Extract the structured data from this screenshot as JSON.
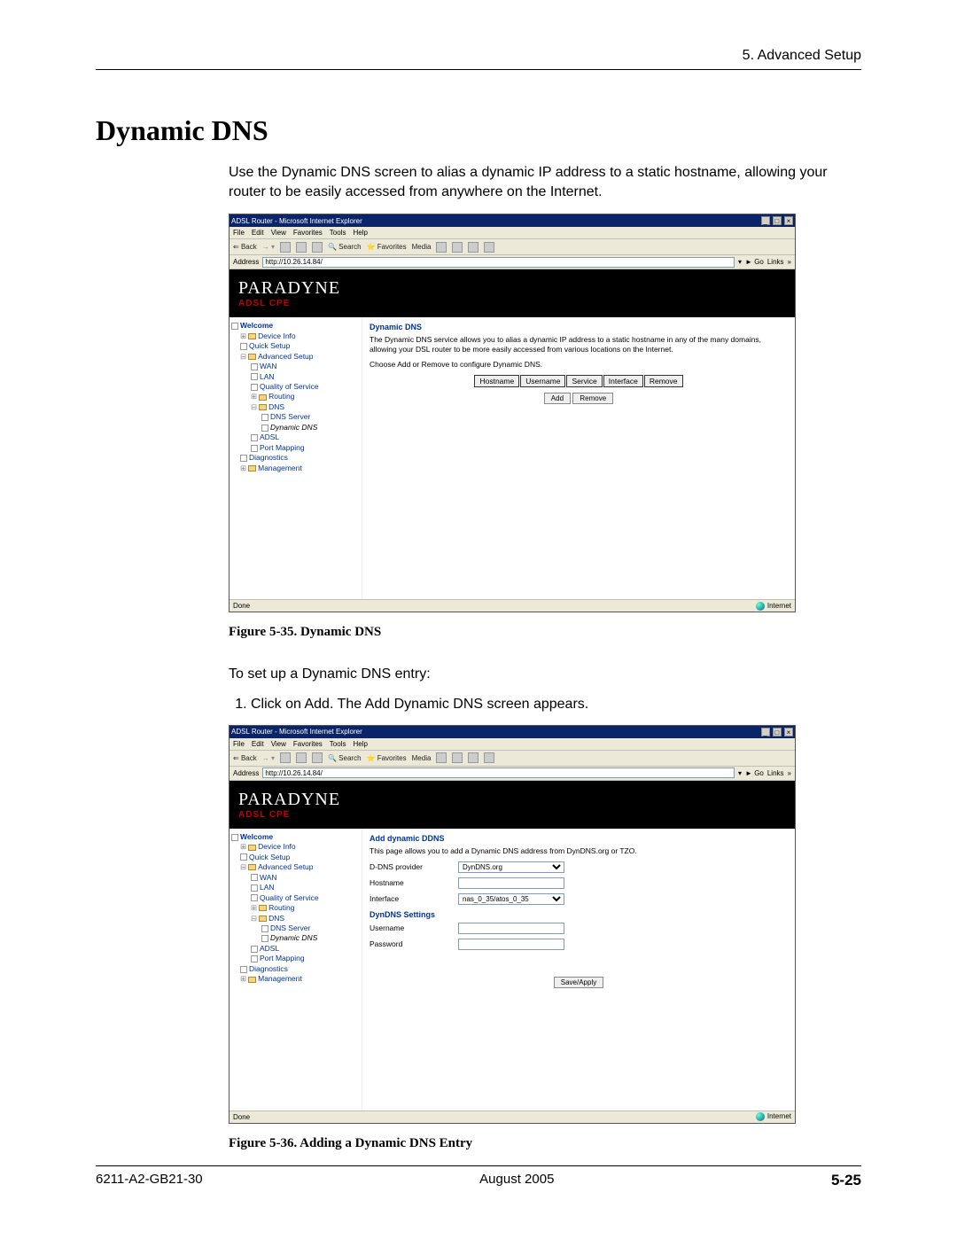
{
  "header": {
    "section": "5. Advanced Setup"
  },
  "title": "Dynamic DNS",
  "intro": "Use the Dynamic DNS screen to alias a dynamic IP address to a static hostname, allowing your router to be easily accessed from anywhere on the Internet.",
  "fig35_caption": "Figure 5-35.   Dynamic DNS",
  "setup_lead": "To set up a Dynamic DNS entry:",
  "step1": "Click on Add. The Add Dynamic DNS screen appears.",
  "fig36_caption": "Figure 5-36.   Adding a Dynamic DNS Entry",
  "browser": {
    "title": "ADSL Router - Microsoft Internet Explorer",
    "menus": [
      "File",
      "Edit",
      "View",
      "Favorites",
      "Tools",
      "Help"
    ],
    "tb_back": "Back",
    "tb_search": "Search",
    "tb_favorites": "Favorites",
    "tb_media": "Media",
    "addr_label": "Address",
    "addr_value": "http://10.26.14.84/",
    "go": "Go",
    "links": "Links",
    "status_done": "Done",
    "status_zone": "Internet"
  },
  "banner": {
    "brand": "PARADYNE",
    "sub": "ADSL CPE"
  },
  "nav": {
    "welcome": "Welcome",
    "device_info": "Device Info",
    "quick_setup": "Quick Setup",
    "advanced_setup": "Advanced Setup",
    "wan": "WAN",
    "lan": "LAN",
    "qos": "Quality of Service",
    "routing": "Routing",
    "dns": "DNS",
    "dns_server": "DNS Server",
    "dynamic_dns": "Dynamic DNS",
    "adsl": "ADSL",
    "port_mapping": "Port Mapping",
    "diagnostics": "Diagnostics",
    "management": "Management"
  },
  "fig35_page": {
    "heading": "Dynamic DNS",
    "p1": "The Dynamic DNS service allows you to alias a dynamic IP address to a static hostname in any of the many domains, allowing your DSL router to be more easily accessed from various locations on the Internet.",
    "p2": "Choose Add or Remove to configure Dynamic DNS.",
    "cols": [
      "Hostname",
      "Username",
      "Service",
      "Interface",
      "Remove"
    ],
    "btn_add": "Add",
    "btn_remove": "Remove"
  },
  "fig36_page": {
    "heading": "Add dynamic DDNS",
    "p1": "This page allows you to add a Dynamic DNS address from DynDNS.org or TZO.",
    "provider_label": "D-DNS provider",
    "provider_value": "DynDNS.org",
    "hostname_label": "Hostname",
    "interface_label": "Interface",
    "interface_value": "nas_0_35/atos_0_35",
    "settings_hdr": "DynDNS Settings",
    "username_label": "Username",
    "password_label": "Password",
    "btn_save": "Save/Apply"
  },
  "footer": {
    "doc": "6211-A2-GB21-30",
    "date": "August 2005",
    "page": "5-25"
  }
}
